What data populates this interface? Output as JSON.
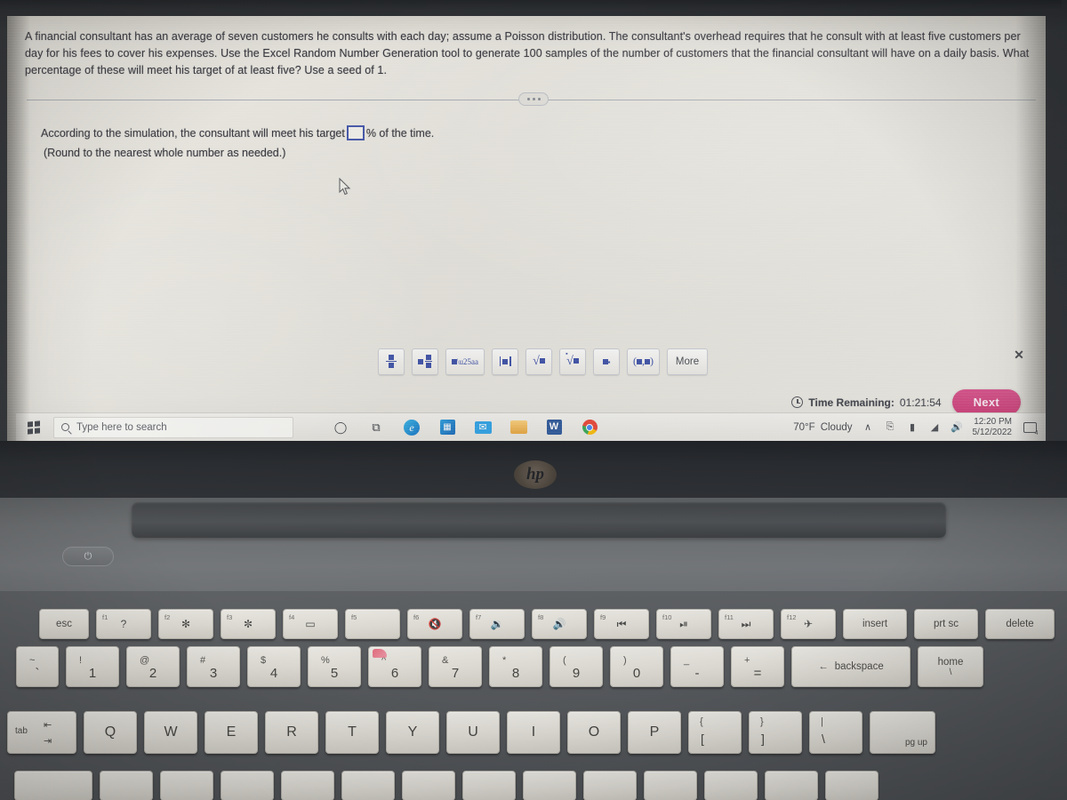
{
  "problem": {
    "statement": "A financial consultant has an average of seven customers he consults with each day; assume a Poisson distribution. The consultant's overhead requires that he consult with at least five customers per day for his fees to cover his expenses. Use the Excel Random Number Generation tool to generate 100 samples of the number of customers that the financial consultant will have on a daily basis. What percentage of these will meet his target of at least five? Use a seed of 1.",
    "answer_prompt_before": "According to the simulation, the consultant will meet his target",
    "answer_prompt_after": "% of the time.",
    "rounding_note": "(Round to the nearest whole number as needed.)",
    "answer_value": ""
  },
  "math_toolbar": {
    "buttons": [
      {
        "name": "fraction",
        "label": "fraction"
      },
      {
        "name": "mixed-number",
        "label": "mixed number"
      },
      {
        "name": "exponent",
        "label": "exponent"
      },
      {
        "name": "absolute-value",
        "label": "absolute value"
      },
      {
        "name": "square-root",
        "label": "square root"
      },
      {
        "name": "nth-root",
        "label": "nth root"
      },
      {
        "name": "subscript",
        "label": "subscript"
      },
      {
        "name": "ordered-pair",
        "label": "ordered pair"
      }
    ],
    "more_label": "More",
    "close_label": "✕"
  },
  "footer": {
    "time_remaining_label": "Time Remaining:",
    "time_remaining_value": "01:21:54",
    "next_label": "Next"
  },
  "taskbar": {
    "search_placeholder": "Type here to search",
    "icons": [
      {
        "name": "cortana-icon",
        "glyph": "○"
      },
      {
        "name": "task-view-icon",
        "glyph": "⧉"
      },
      {
        "name": "edge-icon",
        "glyph": "e"
      },
      {
        "name": "microsoft-store-icon",
        "glyph": "⊞"
      },
      {
        "name": "mail-icon",
        "glyph": "✉"
      },
      {
        "name": "file-explorer-icon",
        "glyph": "☰"
      },
      {
        "name": "word-icon",
        "glyph": "W"
      },
      {
        "name": "chrome-icon",
        "glyph": "◎"
      }
    ],
    "weather_temp": "70°F",
    "weather_condition": "Cloudy",
    "tray": [
      {
        "name": "show-hidden-icons",
        "glyph": "∧"
      },
      {
        "name": "onedrive-icon",
        "glyph": "⬆"
      },
      {
        "name": "battery-icon",
        "glyph": "▭"
      },
      {
        "name": "network-icon",
        "glyph": "◢"
      },
      {
        "name": "volume-icon",
        "glyph": "🔊"
      }
    ],
    "clock_time": "12:20 PM",
    "clock_date": "5/12/2022",
    "notification_glyph": "⌸",
    "notification_count": "4"
  },
  "laptop": {
    "brand": "hp",
    "power_glyph": "⏻"
  },
  "keyboard": {
    "function_row": [
      {
        "name": "esc",
        "label": "esc",
        "fn": "",
        "sym": ""
      },
      {
        "name": "f1",
        "label": "",
        "fn": "f1",
        "sym": "?"
      },
      {
        "name": "f2",
        "label": "",
        "fn": "f2",
        "sym": "✻"
      },
      {
        "name": "f3",
        "label": "",
        "fn": "f3",
        "sym": "✼"
      },
      {
        "name": "f4",
        "label": "",
        "fn": "f4",
        "sym": "▭"
      },
      {
        "name": "f5",
        "label": "",
        "fn": "f5",
        "sym": ""
      },
      {
        "name": "f6",
        "label": "",
        "fn": "f6",
        "sym": "🔇"
      },
      {
        "name": "f7",
        "label": "",
        "fn": "f7",
        "sym": "🔉"
      },
      {
        "name": "f8",
        "label": "",
        "fn": "f8",
        "sym": "🔊"
      },
      {
        "name": "f9",
        "label": "",
        "fn": "f9",
        "sym": "⏮"
      },
      {
        "name": "f10",
        "label": "",
        "fn": "f10",
        "sym": "⏯"
      },
      {
        "name": "f11",
        "label": "",
        "fn": "f11",
        "sym": "⏭"
      },
      {
        "name": "f12",
        "label": "",
        "fn": "f12",
        "sym": "✈"
      },
      {
        "name": "insert",
        "label": "insert",
        "fn": "",
        "sym": ""
      },
      {
        "name": "print-screen",
        "label": "prt sc",
        "fn": "",
        "sym": ""
      },
      {
        "name": "delete",
        "label": "delete",
        "fn": "",
        "sym": ""
      }
    ],
    "number_row": [
      {
        "name": "tilde",
        "up": "~",
        "lo": "`"
      },
      {
        "name": "one",
        "up": "!",
        "lo": "1"
      },
      {
        "name": "two",
        "up": "@",
        "lo": "2"
      },
      {
        "name": "three",
        "up": "#",
        "lo": "3"
      },
      {
        "name": "four",
        "up": "$",
        "lo": "4"
      },
      {
        "name": "five",
        "up": "%",
        "lo": "5"
      },
      {
        "name": "six",
        "up": "^",
        "lo": "6"
      },
      {
        "name": "seven",
        "up": "&",
        "lo": "7"
      },
      {
        "name": "eight",
        "up": "*",
        "lo": "8"
      },
      {
        "name": "nine",
        "up": "(",
        "lo": "9"
      },
      {
        "name": "zero",
        "up": ")",
        "lo": "0"
      },
      {
        "name": "minus",
        "up": "_",
        "lo": "-"
      },
      {
        "name": "equals",
        "up": "+",
        "lo": "="
      }
    ],
    "backspace_label": "backspace",
    "backspace_arrow": "←",
    "home_label": "home",
    "home_sub": "\\",
    "tab_label": "tab",
    "tab_arrow_top": "⇤",
    "tab_arrow_bottom": "⇥",
    "letter_row": [
      {
        "name": "q",
        "lo": "Q",
        "up": ""
      },
      {
        "name": "w",
        "lo": "W",
        "up": ""
      },
      {
        "name": "e",
        "lo": "E",
        "up": ""
      },
      {
        "name": "r",
        "lo": "R",
        "up": ""
      },
      {
        "name": "t",
        "lo": "T",
        "up": ""
      },
      {
        "name": "y",
        "lo": "Y",
        "up": ""
      },
      {
        "name": "u",
        "lo": "U",
        "up": ""
      },
      {
        "name": "i",
        "lo": "I",
        "up": ""
      },
      {
        "name": "o",
        "lo": "O",
        "up": ""
      },
      {
        "name": "p",
        "lo": "P",
        "up": ""
      },
      {
        "name": "bracket-left",
        "lo": "[",
        "up": "{"
      },
      {
        "name": "bracket-right",
        "lo": "]",
        "up": "}"
      },
      {
        "name": "backslash",
        "lo": "\\",
        "up": "|"
      }
    ],
    "page_up_label": "pg up"
  }
}
